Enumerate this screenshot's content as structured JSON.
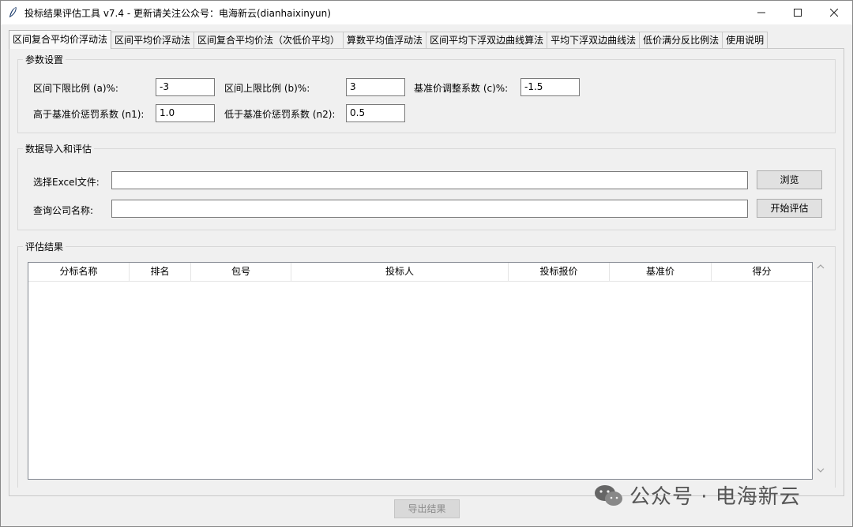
{
  "window": {
    "title": "投标结果评估工具 v7.4 - 更新请关注公众号：电海新云(dianhaixinyun)",
    "title_icon": "feather-icon",
    "controls": {
      "minimize": "—",
      "maximize": "☐",
      "close": "✕"
    }
  },
  "tabs": [
    {
      "label": "区间复合平均价浮动法",
      "active": true
    },
    {
      "label": "区间平均价浮动法"
    },
    {
      "label": "区间复合平均价法（次低价平均）"
    },
    {
      "label": "算数平均值浮动法"
    },
    {
      "label": "区间平均下浮双边曲线算法"
    },
    {
      "label": "平均下浮双边曲线法"
    },
    {
      "label": "低价满分反比例法"
    },
    {
      "label": "使用说明"
    }
  ],
  "params": {
    "title": "参数设置",
    "a_label": "区间下限比例 (a)%:",
    "a_value": "-3",
    "b_label": "区间上限比例 (b)%:",
    "b_value": "3",
    "c_label": "基准价调整系数 (c)%:",
    "c_value": "-1.5",
    "n1_label": "高于基准价惩罚系数 (n1):",
    "n1_value": "1.0",
    "n2_label": "低于基准价惩罚系数 (n2):",
    "n2_value": "0.5"
  },
  "import": {
    "title": "数据导入和评估",
    "file_label": "选择Excel文件:",
    "file_value": "",
    "browse_button": "浏览",
    "company_label": "查询公司名称:",
    "company_value": "",
    "start_button": "开始评估"
  },
  "results": {
    "title": "评估结果",
    "columns": [
      "分标名称",
      "排名",
      "包号",
      "投标人",
      "投标报价",
      "基准价",
      "得分"
    ],
    "rows": []
  },
  "export_button": "导出结果",
  "watermark": "公众号 · 电海新云"
}
